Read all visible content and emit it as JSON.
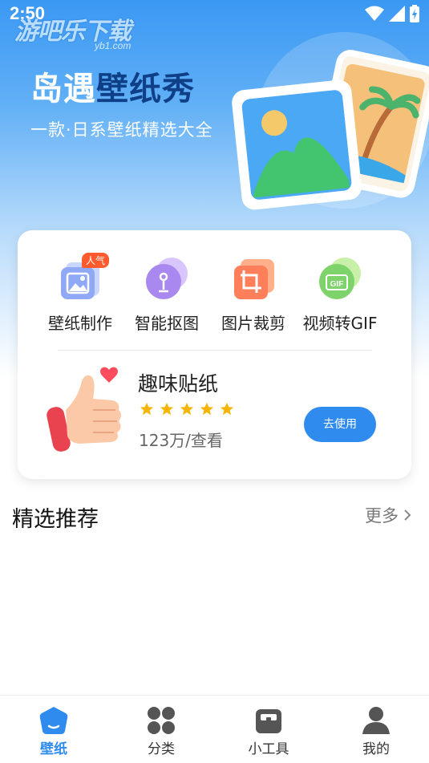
{
  "status_bar": {
    "time": "2:50"
  },
  "watermark": {
    "text": "游吧乐下载",
    "sub": "yb1.com"
  },
  "hero": {
    "title_part1": "岛遇",
    "title_part2": "壁纸秀",
    "subtitle": "一款·日系壁纸精选大全"
  },
  "tools": [
    {
      "label": "壁纸制作",
      "icon": "wallpaper-make-icon",
      "badge": "人气"
    },
    {
      "label": "智能抠图",
      "icon": "smart-cutout-icon"
    },
    {
      "label": "图片裁剪",
      "icon": "crop-icon"
    },
    {
      "label": "视频转GIF",
      "icon": "gif-icon",
      "icon_text": "GIF"
    }
  ],
  "sticker": {
    "title": "趣味贴纸",
    "rating": 5,
    "views": "123万/查看",
    "button": "去使用"
  },
  "featured": {
    "title": "精选推荐",
    "more": "更多"
  },
  "tabbar": [
    {
      "label": "壁纸",
      "icon": "wallpaper-tab-icon",
      "active": true
    },
    {
      "label": "分类",
      "icon": "category-tab-icon",
      "active": false
    },
    {
      "label": "小工具",
      "icon": "toolbox-tab-icon",
      "active": false
    },
    {
      "label": "我的",
      "icon": "profile-tab-icon",
      "active": false
    }
  ],
  "colors": {
    "accent": "#2f8cee",
    "hero_top": "#3a98f3",
    "title_highlight": "#0f3f86",
    "badge": "#ff5b2e",
    "star": "#f7b500"
  }
}
